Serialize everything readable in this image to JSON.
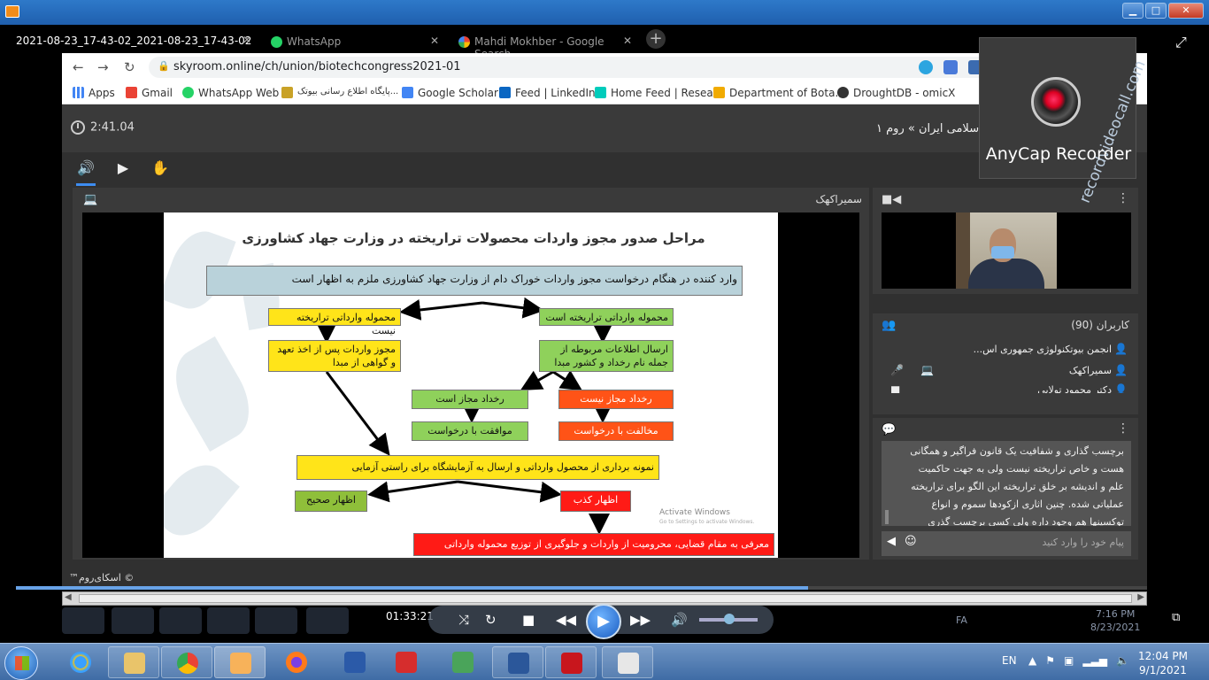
{
  "colors": {
    "accent": "#3d8cf0",
    "title_bar": "#2e79c9",
    "taskbar": "#4f7db5"
  },
  "recording": {
    "title": "2021-08-23_17-43-02_2021-08-23_17-43-02"
  },
  "tabs": [
    {
      "label": "WhatsApp",
      "icon": "whatsapp-icon"
    },
    {
      "label": "Mahdi Mokhber - Google Search",
      "icon": "google-icon"
    }
  ],
  "address": {
    "url": "skyroom.online/ch/union/biotechcongress2021-01"
  },
  "bookmarks": [
    {
      "label": "Apps",
      "icon": "apps-grid-icon"
    },
    {
      "label": "Gmail",
      "icon": "gmail-icon"
    },
    {
      "label": "WhatsApp Web",
      "icon": "whatsapp-icon"
    },
    {
      "label": "پایگاه اطلاع رسانی بیوتک...",
      "icon": "site-icon"
    },
    {
      "label": "Google Scholar",
      "icon": "scholar-icon"
    },
    {
      "label": "Feed | LinkedIn",
      "icon": "linkedin-icon"
    },
    {
      "label": "Home Feed | Resea...",
      "icon": "researchgate-icon"
    },
    {
      "label": "Department of Bota...",
      "icon": "ucr-icon"
    },
    {
      "label": "DroughtDB - omicX",
      "icon": "omicx-icon"
    }
  ],
  "room": {
    "timer": "2:41.04",
    "breadcrumb": "ی اسلامی ایران » روم ۱",
    "presenter": "سمیراکهک",
    "copyright": "© اسکای‌روم™"
  },
  "slide": {
    "title": "مراحل صدور مجوز واردات محصولات تراریخته در وزارت جهاد کشاورزی",
    "intro": "وارد کننده در هنگام درخواست مجوز واردات خوراک دام از وزارت جهاد کشاورزی ملزم به اظهار است",
    "not_gm": "محموله وارداتی تراریخته نیست",
    "is_gm": "محموله وارداتی تراریخته است",
    "import_permit": "مجوز واردات پس از اخذ تعهد و گواهی از مبدا",
    "send_info": "ارسال اطلاعات مربوطه از جمله نام رخداد و کشور مبدا",
    "event_allowed": "رخداد مجاز است",
    "event_not_allowed": "رخداد مجاز نیست",
    "agree": "موافقت با درخواست",
    "disagree": "مخالفت با درخواست",
    "sampling": "نمونه برداری از محصول وارداتی و ارسال به آزمایشگاه برای راستی آزمایی",
    "correct": "اظهار صحیح",
    "false_decl": "اظهار کذب",
    "penalty": "معرفی به مقام قضایی، محرومیت از واردات و جلوگیری از توزیع محموله وارداتی",
    "activate": "Activate Windows",
    "activate_sub": "Go to Settings to activate Windows."
  },
  "users_panel": {
    "title": "کاربران (90)",
    "users": [
      "انجمن بیوتکنولوژی جمهوری اس...",
      "سمیراکهک",
      "دکتر محمود تولایی"
    ]
  },
  "chat": {
    "message": "برچسب گذاری و شفافیت یک قانون فراگیر و همگانی هست و خاص تراریخته نیست ولی به جهت حاکمیت علم و اندیشه بر خلق تراریخته این الگو برای تراریخته عملیاتی شده. چنین اثاری ازکودها سموم و انواع توکسینها هم وجود داره ولی کسی برچسب گذری",
    "placeholder": "پیام خود را وارد کنید"
  },
  "logo": {
    "text": "recordvideocall.com",
    "caption": "AnyCap Recorder"
  },
  "player": {
    "time": "01:33:21",
    "progress": 0.7
  },
  "ghost_tray": {
    "lang": "FA",
    "time": "7:16 PM",
    "date": "8/23/2021"
  },
  "taskbar": {
    "lang": "EN",
    "time": "12:04 PM",
    "date": "9/1/2021",
    "apps": [
      "ie-icon",
      "explorer-icon",
      "chrome-icon",
      "media-player-icon",
      "firefox-icon",
      "network-tool-icon",
      "pdf-tool-icon",
      "connect-icon",
      "word-icon",
      "acrobat-icon",
      "java-icon"
    ]
  }
}
